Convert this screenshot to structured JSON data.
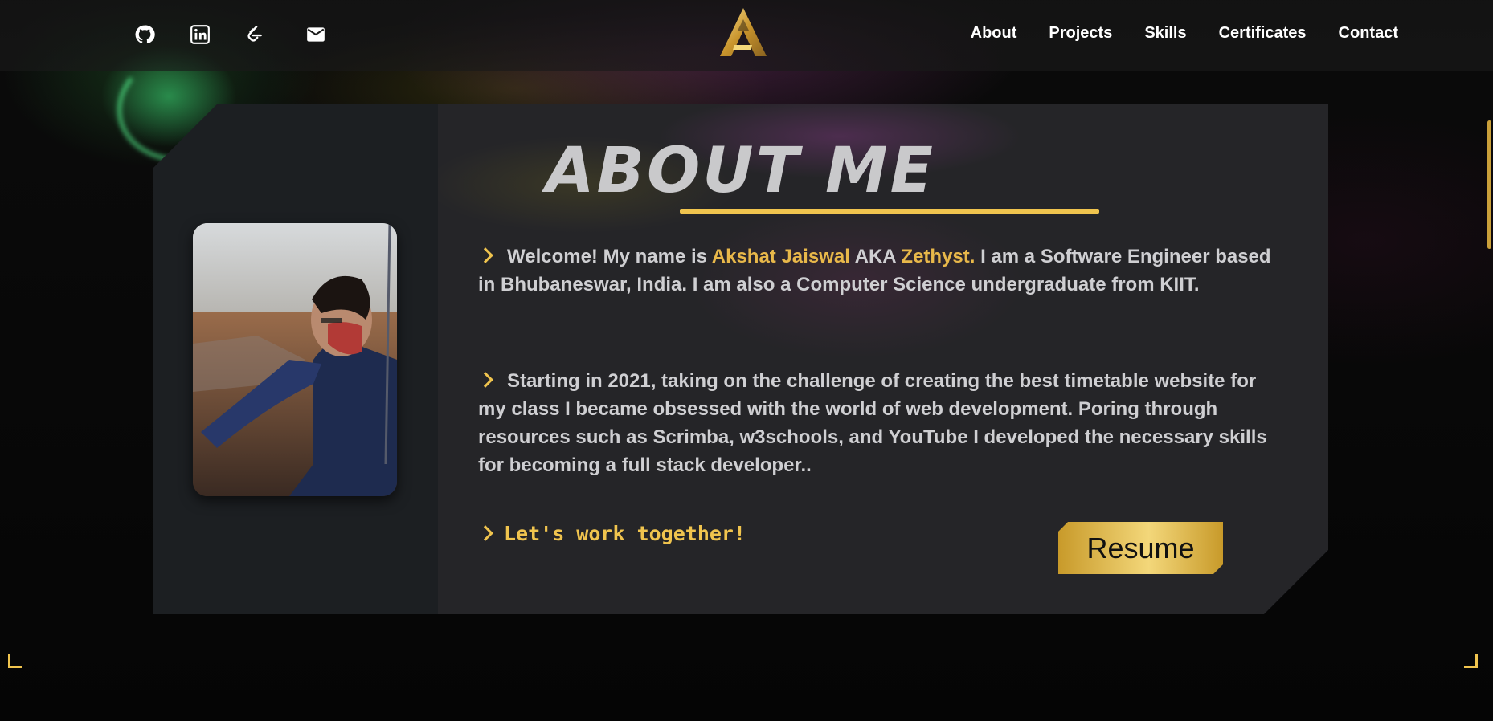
{
  "header": {
    "social": [
      {
        "name": "github",
        "icon": "github-icon"
      },
      {
        "name": "linkedin",
        "icon": "linkedin-icon"
      },
      {
        "name": "leetcode",
        "icon": "leetcode-icon"
      },
      {
        "name": "email",
        "icon": "mail-icon"
      }
    ],
    "logo_icon": "gold-a-logo",
    "nav": [
      "About",
      "Projects",
      "Skills",
      "Certificates",
      "Contact"
    ]
  },
  "about": {
    "title": "ABOUT ME",
    "intro_prefix": "Welcome! My name is ",
    "name": "Akshat Jaiswal",
    "aka": " AKA ",
    "alias": "Zethyst.",
    "intro_rest": " I am a Software Engineer based in Bhubaneswar, India. I am also a Computer Science undergraduate from KIIT.",
    "para2": "Starting in 2021, taking on the challenge of creating the best timetable website for my class I became obsessed with the world of web development. Poring through resources such as Scrimba, w3schools, and YouTube I developed the necessary skills for becoming a full stack developer..",
    "cta": "Let's work together!",
    "resume_label": "Resume"
  },
  "colors": {
    "accent": "#f0c44e",
    "highlight": "#e8b84a",
    "card": "#252528",
    "card_left": "#1c1f22"
  }
}
